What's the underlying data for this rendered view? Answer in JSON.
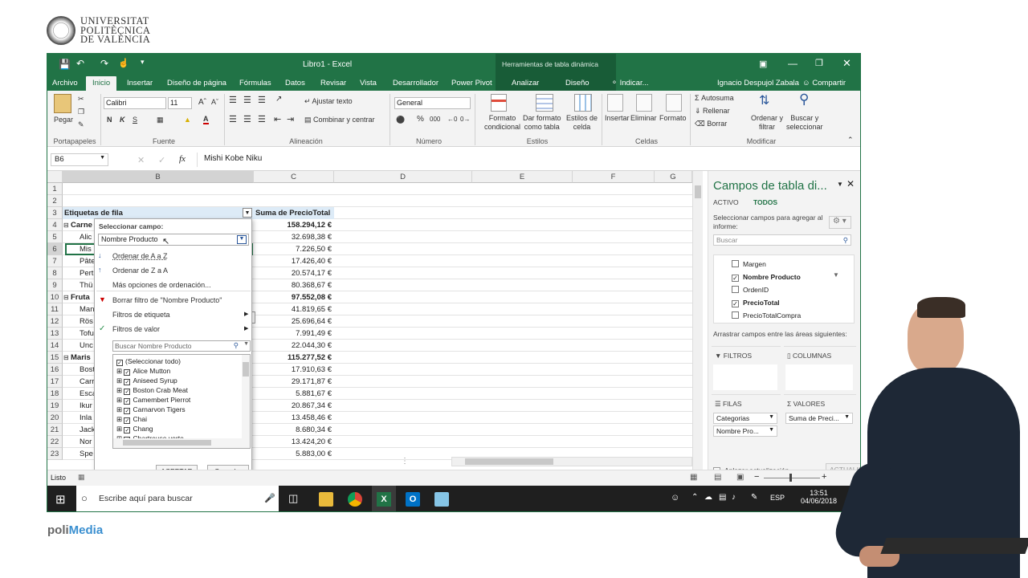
{
  "branding": {
    "university_line1": "UNIVERSITAT",
    "university_line2": "POLITÈCNICA",
    "university_line3": "DE VALÈNCIA",
    "polimedia_a": "poli",
    "polimedia_b": "Media"
  },
  "window": {
    "title": "Libro1 - Excel",
    "context_title": "Herramientas de tabla dinámica",
    "user": "Ignacio Despujol Zabala",
    "share": "Compartir",
    "tell_me": "Indicar..."
  },
  "tabs": [
    "Archivo",
    "Inicio",
    "Insertar",
    "Diseño de página",
    "Fórmulas",
    "Datos",
    "Revisar",
    "Vista",
    "Desarrollador",
    "Power Pivot",
    "Analizar",
    "Diseño"
  ],
  "ribbon": {
    "paste": "Pegar",
    "clipboard": "Portapapeles",
    "font_name": "Calibri",
    "font_size": "11",
    "bold": "N",
    "italic": "K",
    "underline": "S",
    "font_group": "Fuente",
    "wrap": "Ajustar texto",
    "merge": "Combinar y centrar",
    "alignment_group": "Alineación",
    "number_format": "General",
    "percent": "%",
    "thousands": "000",
    "number_group": "Número",
    "cond_format": "Formato",
    "cond_format2": "condicional",
    "as_table": "Dar formato",
    "as_table2": "como tabla",
    "cell_styles": "Estilos de",
    "cell_styles2": "celda",
    "styles_group": "Estilos",
    "insert": "Insertar",
    "delete": "Eliminar",
    "format": "Formato",
    "cells_group": "Celdas",
    "autosum": "Autosuma",
    "fill": "Rellenar",
    "clear": "Borrar",
    "sort": "Ordenar y",
    "sort2": "filtrar",
    "find": "Buscar y",
    "find2": "seleccionar",
    "edit_group": "Modificar"
  },
  "formula_bar": {
    "name_box": "B6",
    "fx": "fx",
    "value": "Mishi Kobe Niku"
  },
  "columns": [
    "B",
    "C",
    "D",
    "E",
    "F",
    "G"
  ],
  "rows": [
    {
      "n": "1",
      "b": "",
      "c": ""
    },
    {
      "n": "2",
      "b": "",
      "c": ""
    },
    {
      "n": "3",
      "b": "Etiquetas de fila",
      "c": "Suma de PrecioTotal"
    },
    {
      "n": "4",
      "b": "Carne",
      "c": "158.294,12 €"
    },
    {
      "n": "5",
      "b": "Alic",
      "c": "32.698,38 €"
    },
    {
      "n": "6",
      "b": "Mis",
      "c": "7.226,50 €"
    },
    {
      "n": "7",
      "b": "Pâte",
      "c": "17.426,40 €"
    },
    {
      "n": "8",
      "b": "Pert",
      "c": "20.574,17 €"
    },
    {
      "n": "9",
      "b": "Thü",
      "c": "80.368,67 €"
    },
    {
      "n": "10",
      "b": "Fruta",
      "c": "97.552,08 €"
    },
    {
      "n": "11",
      "b": "Man",
      "c": "41.819,65 €"
    },
    {
      "n": "12",
      "b": "Rös",
      "c": "25.696,64 €"
    },
    {
      "n": "13",
      "b": "Tofu",
      "c": "7.991,49 €"
    },
    {
      "n": "14",
      "b": "Unc",
      "c": "22.044,30 €"
    },
    {
      "n": "15",
      "b": "Maris",
      "c": "115.277,52 €"
    },
    {
      "n": "16",
      "b": "Bost",
      "c": "17.910,63 €"
    },
    {
      "n": "17",
      "b": "Carr",
      "c": "29.171,87 €"
    },
    {
      "n": "18",
      "b": "Esca",
      "c": "5.881,67 €"
    },
    {
      "n": "19",
      "b": "Ikur",
      "c": "20.867,34 €"
    },
    {
      "n": "20",
      "b": "Inla",
      "c": "13.458,46 €"
    },
    {
      "n": "21",
      "b": "Jack",
      "c": "8.680,34 €"
    },
    {
      "n": "22",
      "b": "Nor",
      "c": "13.424,20 €"
    },
    {
      "n": "23",
      "b": "Spe",
      "c": "5.883,00 €"
    }
  ],
  "popup": {
    "select_field": "Seleccionar campo:",
    "field": "Nombre Producto",
    "sort_az": "Ordenar de A a Z",
    "sort_za": "Ordenar de Z a A",
    "more_sort": "Más opciones de ordenación...",
    "clear_filter": "Borrar filtro de \"Nombre Producto\"",
    "label_filters": "Filtros de etiqueta",
    "value_filters": "Filtros de valor",
    "search": "Buscar Nombre Producto",
    "items": [
      "(Seleccionar todo)",
      "Alice Mutton",
      "Aniseed Syrup",
      "Boston Crab Meat",
      "Camembert Pierrot",
      "Carnarvon Tigers",
      "Chai",
      "Chang",
      "Chartreuse verte"
    ],
    "ok": "ACEPTAR",
    "cancel": "Cancelar"
  },
  "pane": {
    "title": "Campos de tabla di...",
    "tab_active": "ACTIVO",
    "tab_all": "TODOS",
    "instructions": "Seleccionar campos para agregar al informe:",
    "search": "Buscar",
    "fields": [
      {
        "name": "Margen",
        "checked": false
      },
      {
        "name": "Nombre Producto",
        "checked": true
      },
      {
        "name": "OrdenID",
        "checked": false
      },
      {
        "name": "PrecioTotal",
        "checked": true
      },
      {
        "name": "PrecioTotalCompra",
        "checked": false
      }
    ],
    "drag_text": "Arrastrar campos entre las áreas siguientes:",
    "filters": "FILTROS",
    "columns": "COLUMNAS",
    "rows": "FILAS",
    "values": "VALORES",
    "row_items": [
      "Categorias",
      "Nombre Pro..."
    ],
    "value_items": [
      "Suma de Preci..."
    ],
    "defer": "Aplazar actualización...",
    "update": "ACTUALIZAR"
  },
  "status": {
    "ready": "Listo"
  },
  "taskbar": {
    "search": "Escribe aquí para buscar",
    "lang": "ESP",
    "time": "13:51",
    "date": "04/06/2018"
  }
}
